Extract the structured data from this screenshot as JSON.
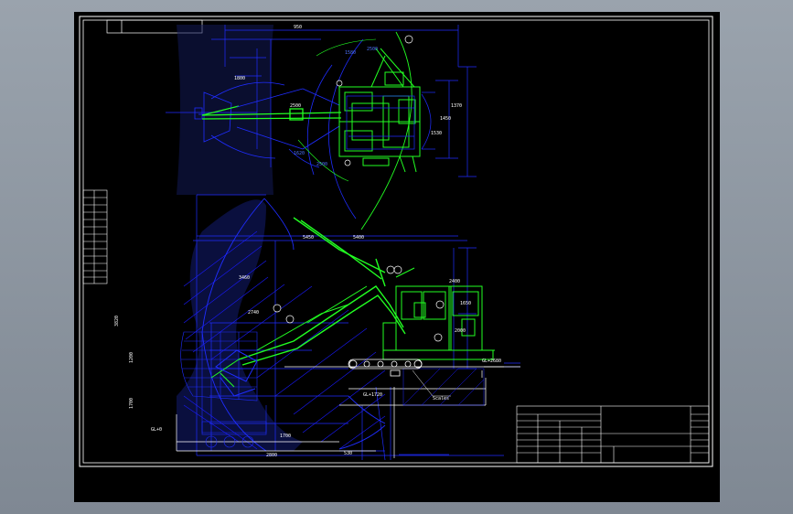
{
  "colors": {
    "background": "#000000",
    "frame": "#ffffff",
    "machine": "#22ff22",
    "dimension": "#1f2dff",
    "hatch": "#1a1aff"
  },
  "top_view": {
    "dims": [
      "950",
      "1800",
      "1580",
      "2500",
      "1620",
      "2500",
      "1450",
      "1370",
      "1530",
      "2500"
    ]
  },
  "side_view": {
    "dims": [
      "5450",
      "5400",
      "3820",
      "3460",
      "2740",
      "1200",
      "1700",
      "2400",
      "1650",
      "2000",
      "1700",
      "2800",
      "530"
    ],
    "sections": [
      "GL+2680",
      "GL+1720",
      "GL+0"
    ],
    "note": "Scales"
  },
  "title_block": {
    "rows": 4,
    "note": ""
  }
}
